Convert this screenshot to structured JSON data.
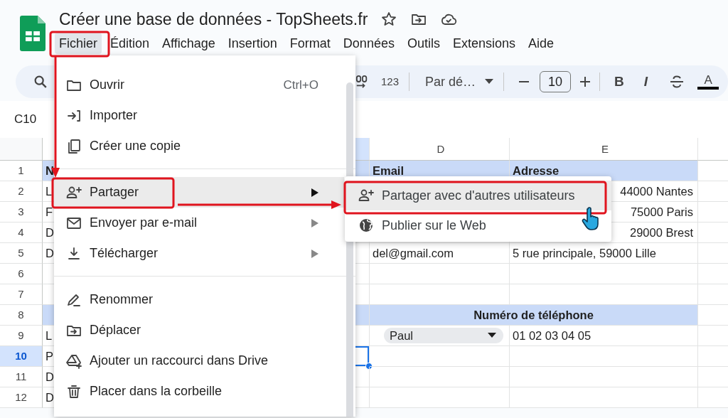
{
  "document": {
    "title": "Créer une base de données - TopSheets.fr"
  },
  "menubar": [
    {
      "label": "Fichier",
      "selected": true
    },
    {
      "label": "Édition",
      "selected": false
    },
    {
      "label": "Affichage",
      "selected": false
    },
    {
      "label": "Insertion",
      "selected": false
    },
    {
      "label": "Format",
      "selected": false
    },
    {
      "label": "Données",
      "selected": false
    },
    {
      "label": "Outils",
      "selected": false
    },
    {
      "label": "Extensions",
      "selected": false
    },
    {
      "label": "Aide",
      "selected": false
    }
  ],
  "toolbar": {
    "number_format": "123",
    "font": "Par dé…",
    "font_size": "10",
    "bold": "B",
    "italic": "I",
    "text_color": "A"
  },
  "name_box": "C10",
  "sheet": {
    "column_headers": [
      "D",
      "E"
    ],
    "rows": [
      {
        "number": "1",
        "selected": false,
        "kind": "header",
        "col_a": "N",
        "col_d": "Email",
        "col_d_dropdown": false,
        "col_e": "Adresse"
      },
      {
        "number": "2",
        "selected": false,
        "kind": "data",
        "col_a": "L",
        "col_e": "44000 Nantes"
      },
      {
        "number": "3",
        "selected": false,
        "kind": "data",
        "col_a": "F",
        "col_e": "75000 Paris"
      },
      {
        "number": "4",
        "selected": false,
        "kind": "data",
        "col_a": "D",
        "col_e": "29000 Brest"
      },
      {
        "number": "5",
        "selected": false,
        "kind": "data",
        "col_a": "D",
        "col_d": "del@gmail.com",
        "col_d_dropdown": false,
        "col_e": "5 rue principale, 59000 Lille"
      },
      {
        "number": "6",
        "selected": false,
        "kind": "data"
      },
      {
        "number": "7",
        "selected": false,
        "kind": "data"
      },
      {
        "number": "8",
        "selected": false,
        "kind": "merged_header",
        "col_de": "Numéro de téléphone"
      },
      {
        "number": "9",
        "selected": false,
        "kind": "data",
        "col_a": "L",
        "col_d": "Paul",
        "col_d_dropdown": true,
        "col_e": "01 02 03 04 05"
      },
      {
        "number": "10",
        "selected": true,
        "kind": "data",
        "col_a": "P"
      },
      {
        "number": "11",
        "selected": false,
        "kind": "data",
        "col_a": "D"
      },
      {
        "number": "12",
        "selected": false,
        "kind": "data",
        "col_a": "D"
      }
    ]
  },
  "file_menu": {
    "groups": [
      [
        {
          "label": "Ouvrir",
          "shortcut": "Ctrl+O",
          "submenu": false,
          "selected": false
        },
        {
          "label": "Importer",
          "submenu": false,
          "selected": false
        },
        {
          "label": "Créer une copie",
          "submenu": false,
          "selected": false
        }
      ],
      [
        {
          "label": "Partager",
          "submenu": true,
          "selected": true
        },
        {
          "label": "Envoyer par e-mail",
          "submenu": true,
          "selected": false
        },
        {
          "label": "Télécharger",
          "submenu": true,
          "selected": false
        }
      ],
      [
        {
          "label": "Renommer",
          "submenu": false,
          "selected": false
        },
        {
          "label": "Déplacer",
          "submenu": false,
          "selected": false
        },
        {
          "label": "Ajouter un raccourci dans Drive",
          "submenu": false,
          "selected": false
        },
        {
          "label": "Placer dans la corbeille",
          "submenu": false,
          "selected": false
        }
      ]
    ]
  },
  "share_submenu": [
    {
      "label": "Partager avec d'autres utilisateurs",
      "selected": true
    },
    {
      "label": "Publier sur le Web",
      "selected": false
    }
  ]
}
